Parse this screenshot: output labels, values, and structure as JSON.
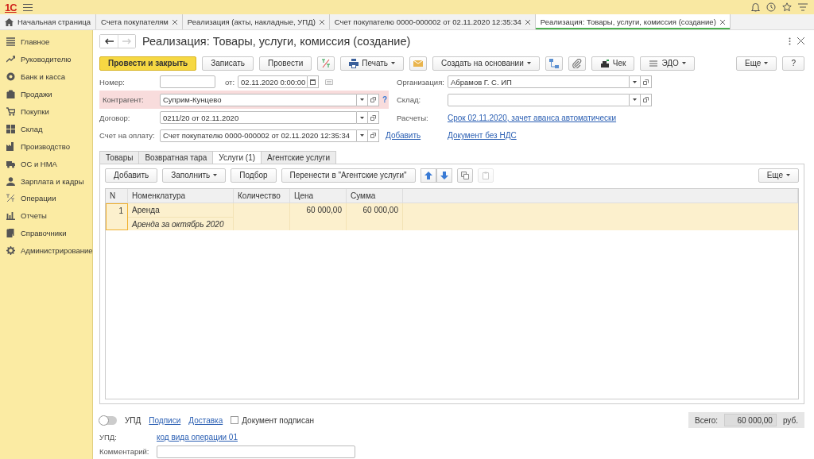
{
  "app": {
    "logo": "1С"
  },
  "tabs": [
    {
      "label": "Начальная страница",
      "selected": false,
      "kind": "home"
    },
    {
      "label": "Счета покупателям",
      "selected": false,
      "kind": "doc"
    },
    {
      "label": "Реализация (акты, накладные, УПД)",
      "selected": false,
      "kind": "doc"
    },
    {
      "label": "Счет покупателю 0000-000002 от 02.11.2020 12:35:34",
      "selected": false,
      "kind": "doc"
    },
    {
      "label": "Реализация: Товары, услуги, комиссия (создание)",
      "selected": true,
      "kind": "doc"
    }
  ],
  "sidebar": {
    "items": [
      {
        "label": "Главное"
      },
      {
        "label": "Руководителю"
      },
      {
        "label": "Банк и касса"
      },
      {
        "label": "Продажи"
      },
      {
        "label": "Покупки"
      },
      {
        "label": "Склад"
      },
      {
        "label": "Производство"
      },
      {
        "label": "ОС и НМА"
      },
      {
        "label": "Зарплата и кадры"
      },
      {
        "label": "Операции"
      },
      {
        "label": "Отчеты"
      },
      {
        "label": "Справочники"
      },
      {
        "label": "Администрирование"
      }
    ]
  },
  "form": {
    "title": "Реализация: Товары, услуги, комиссия (создание)",
    "nav": [
      {
        "kind": "back",
        "disabled": false
      },
      {
        "kind": "forward",
        "disabled": true
      }
    ],
    "toolbar": [
      {
        "kind": "button",
        "label": "Провести и закрыть",
        "primary": true,
        "dropdown": false
      },
      {
        "kind": "button",
        "label": "Записать",
        "primary": false,
        "dropdown": false
      },
      {
        "kind": "button",
        "label": "Провести",
        "primary": false,
        "dropdown": false
      },
      {
        "kind": "icon",
        "primary": false,
        "dropdown": false
      },
      {
        "kind": "icon_button",
        "label": "Печать",
        "primary": false,
        "dropdown": true
      },
      {
        "kind": "icon",
        "primary": false,
        "dropdown": false
      },
      {
        "kind": "button",
        "label": "Создать на основании",
        "primary": false,
        "dropdown": true
      },
      {
        "kind": "icon",
        "primary": false,
        "dropdown": false
      },
      {
        "kind": "icon",
        "primary": false,
        "dropdown": false
      },
      {
        "kind": "icon_button",
        "label": "Чек",
        "primary": false,
        "dropdown": false
      },
      {
        "kind": "icon_button",
        "label": "ЭДО",
        "primary": false,
        "dropdown": true
      }
    ],
    "toolbar_right": [
      {
        "label": "Еще",
        "dropdown": true
      },
      {
        "label": "?",
        "dropdown": false
      }
    ],
    "left_fields": [
      {
        "kind": "number_date",
        "label": "Номер:",
        "date_label": "от:",
        "date_value": "02.11.2020  0:00:00",
        "highlighted": false
      },
      {
        "kind": "select",
        "label": "Контрагент:",
        "value": "Суприм-Кунцево",
        "highlighted": true,
        "help": "?"
      },
      {
        "kind": "select",
        "label": "Договор:",
        "value": "0211/20 от 02.11.2020",
        "highlighted": false
      },
      {
        "kind": "select",
        "label": "Счет на оплату:",
        "value": "Счет покупателю 0000-000002 от 02.11.2020 12:35:34",
        "highlighted": false,
        "link": "Добавить"
      }
    ],
    "right_fields": [
      {
        "kind": "select",
        "label": "Организация:",
        "value": "Абрамов Г. С. ИП"
      },
      {
        "kind": "select",
        "label": "Склад:"
      },
      {
        "kind": "link",
        "label": "Расчеты:",
        "value": "Срок 02.11.2020, зачет аванса автоматически"
      },
      {
        "kind": "link",
        "value": "Документ без НДС"
      }
    ],
    "inner_tabs": [
      {
        "label": "Товары",
        "selected": false
      },
      {
        "label": "Возвратная тара",
        "selected": false
      },
      {
        "label": "Услуги (1)",
        "selected": true
      },
      {
        "label": "Агентские услуги",
        "selected": false
      }
    ],
    "inner_toolbar": [
      {
        "kind": "button",
        "label": "Добавить",
        "dropdown": false,
        "disabled": false
      },
      {
        "kind": "button",
        "label": "Заполнить",
        "dropdown": true,
        "disabled": false
      },
      {
        "kind": "button",
        "label": "Подбор",
        "dropdown": false,
        "disabled": false
      },
      {
        "kind": "button",
        "label": "Перенести в \"Агентские услуги\"",
        "dropdown": false,
        "disabled": false
      },
      {
        "kind": "icon",
        "dropdown": false,
        "disabled": false
      },
      {
        "kind": "icon",
        "dropdown": false,
        "disabled": false
      },
      {
        "kind": "icon",
        "dropdown": false,
        "disabled": false
      },
      {
        "kind": "icon",
        "dropdown": false,
        "disabled": true
      }
    ],
    "inner_toolbar_right": [
      {
        "label": "Еще",
        "dropdown": true
      }
    ],
    "table": {
      "columns": [
        "N",
        "Номенклатура",
        "Количество",
        "Цена",
        "Сумма"
      ],
      "rows": [
        {
          "n": "1",
          "name": "Аренда",
          "content": "Аренда за октябрь 2020",
          "price": "60 000,00",
          "sum": "60 000,00",
          "selected": true
        }
      ]
    },
    "footer": {
      "upd_toggle": {
        "label": "УПД",
        "on": false
      },
      "links": [
        "Подписи",
        "Доставка"
      ],
      "signed": {
        "label": "Документ подписан",
        "checked": false
      },
      "total": {
        "label": "Всего:",
        "value": "60 000,00",
        "currency": "руб."
      },
      "upd": {
        "label": "УПД:",
        "link": "код вида операции 01"
      },
      "comment": {
        "label": "Комментарий:"
      }
    }
  }
}
